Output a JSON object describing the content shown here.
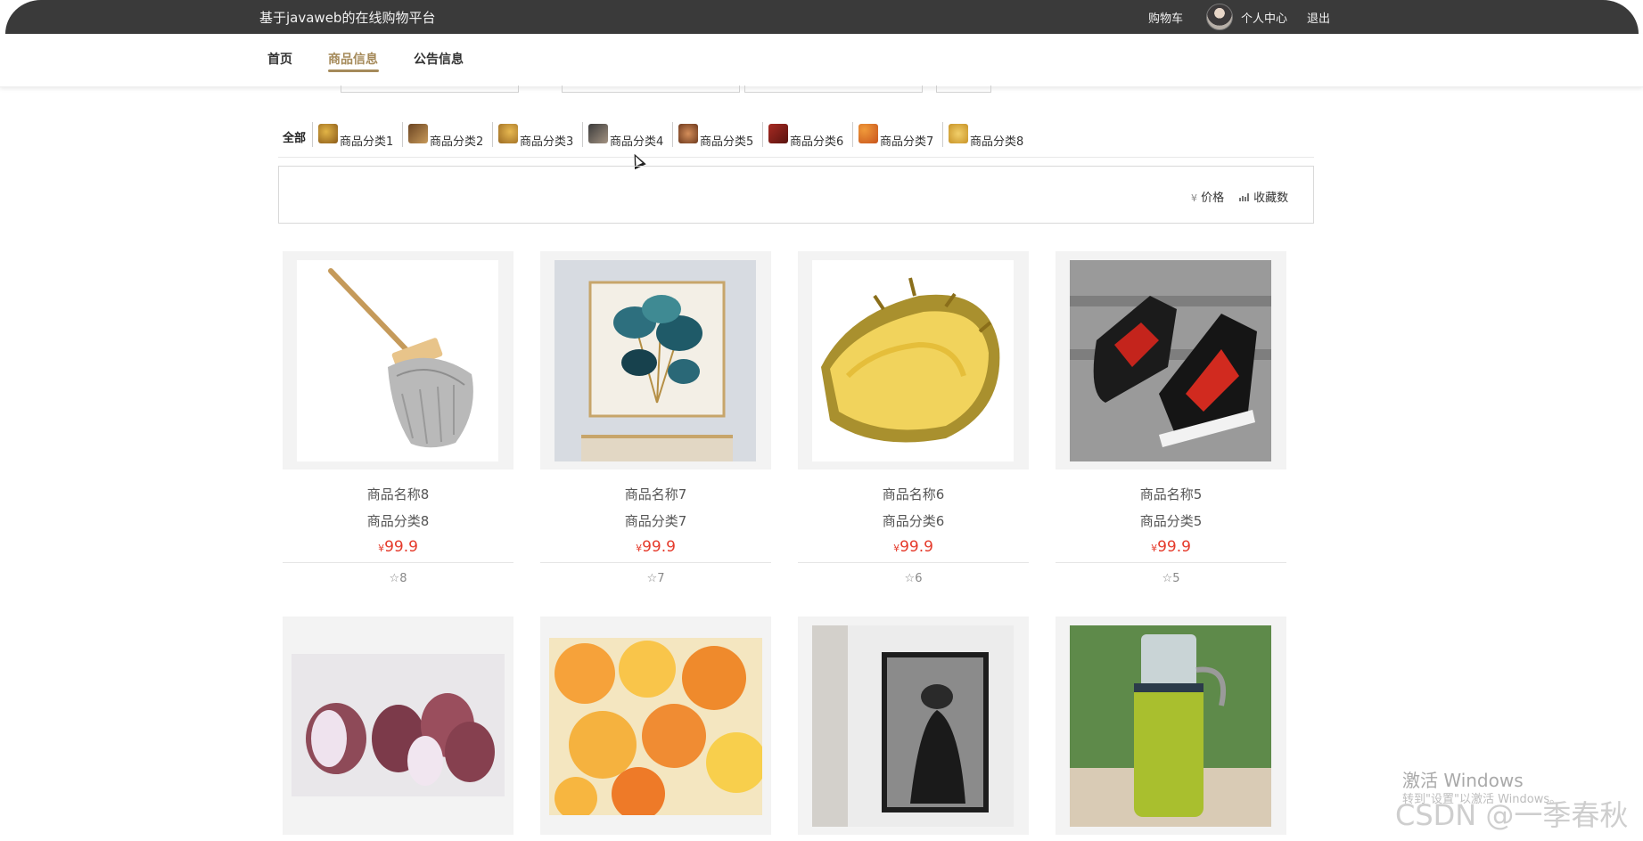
{
  "header": {
    "site_title": "基于javaweb的在线购物平台",
    "cart": "购物车",
    "profile": "个人中心",
    "logout": "退出"
  },
  "nav": {
    "items": [
      {
        "label": "首页"
      },
      {
        "label": "商品信息"
      },
      {
        "label": "公告信息"
      }
    ],
    "active_index": 1,
    "accent_color": "#a58a5a"
  },
  "categories": {
    "all": "全部",
    "items": [
      {
        "label": "商品分类1"
      },
      {
        "label": "商品分类2"
      },
      {
        "label": "商品分类3"
      },
      {
        "label": "商品分类4"
      },
      {
        "label": "商品分类5"
      },
      {
        "label": "商品分类6"
      },
      {
        "label": "商品分类7"
      },
      {
        "label": "商品分类8"
      }
    ]
  },
  "sort": {
    "price_icon": "¥",
    "price": "价格",
    "fav_icon": "bar-chart-icon",
    "favorites": "收藏数"
  },
  "products": [
    {
      "name": "商品名称8",
      "category": "商品分类8",
      "currency": "¥",
      "price": "99.9",
      "favorites": "8",
      "image": "mop"
    },
    {
      "name": "商品名称7",
      "category": "商品分类7",
      "currency": "¥",
      "price": "99.9",
      "favorites": "7",
      "image": "ginkgo-painting"
    },
    {
      "name": "商品名称6",
      "category": "商品分类6",
      "currency": "¥",
      "price": "99.9",
      "favorites": "6",
      "image": "durian"
    },
    {
      "name": "商品名称5",
      "category": "商品分类5",
      "currency": "¥",
      "price": "99.9",
      "favorites": "5",
      "image": "sneakers"
    },
    {
      "image": "shallots"
    },
    {
      "image": "jelly-cups"
    },
    {
      "image": "portrait-painting"
    },
    {
      "image": "water-bottle"
    }
  ],
  "price_color": "#e53b2c",
  "watermark": {
    "activate": "激活 Windows",
    "activate_sub": "转到\"设置\"以激活 Windows。",
    "csdn": "CSDN @一季春秋"
  }
}
